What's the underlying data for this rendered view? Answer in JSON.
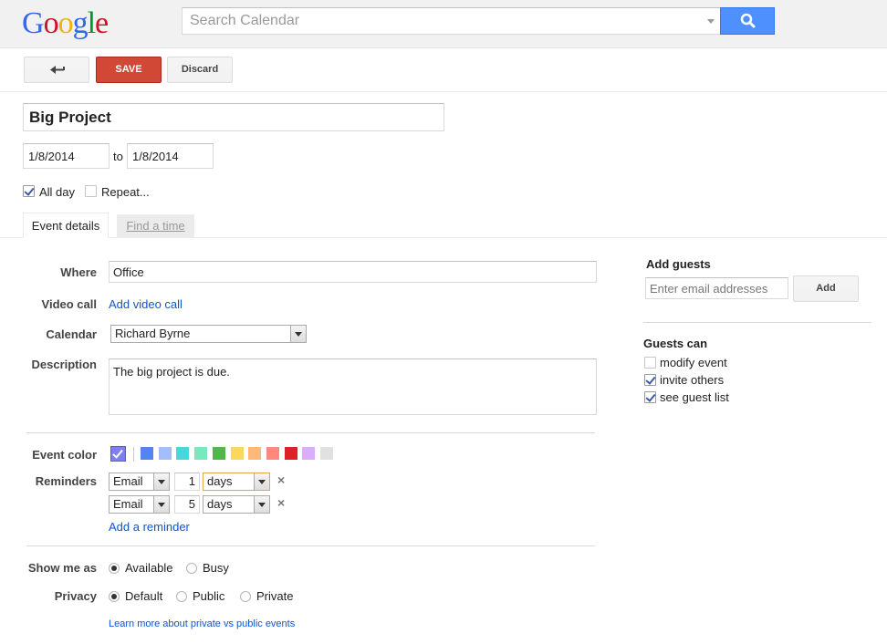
{
  "header": {
    "logo_text": "Google",
    "search_placeholder": "Search Calendar"
  },
  "toolbar": {
    "save_label": "SAVE",
    "discard_label": "Discard"
  },
  "event": {
    "title": "Big Project",
    "start_date": "1/8/2014",
    "to_label": "to",
    "end_date": "1/8/2014",
    "all_day_label": "All day",
    "all_day_checked": true,
    "repeat_label": "Repeat...",
    "repeat_checked": false
  },
  "tabs": {
    "details": "Event details",
    "find_time": "Find a time"
  },
  "form": {
    "where_label": "Where",
    "where_value": "Office",
    "video_label": "Video call",
    "video_link": "Add video call",
    "calendar_label": "Calendar",
    "calendar_value": "Richard Byrne",
    "description_label": "Description",
    "description_value": "The big project is due.",
    "color_label": "Event color",
    "colors": [
      "#5484ed",
      "#a4bdfc",
      "#46d6db",
      "#7ae7bf",
      "#51b749",
      "#fbd75b",
      "#ffb878",
      "#ff887c",
      "#dc2127",
      "#dbadff",
      "#e1e1e1"
    ],
    "selected_color": "#7f7ff0",
    "reminders_label": "Reminders",
    "reminders": [
      {
        "method": "Email",
        "amount": "1",
        "unit": "days"
      },
      {
        "method": "Email",
        "amount": "5",
        "unit": "days"
      }
    ],
    "add_reminder": "Add a reminder",
    "show_me_as_label": "Show me as",
    "show_available": "Available",
    "show_busy": "Busy",
    "privacy_label": "Privacy",
    "privacy_default": "Default",
    "privacy_public": "Public",
    "privacy_private": "Private",
    "learn_more": "Learn more about private vs public events"
  },
  "guests": {
    "title": "Add guests",
    "input_placeholder": "Enter email addresses",
    "add_label": "Add",
    "can_title": "Guests can",
    "permissions": [
      {
        "label": "modify event",
        "checked": false
      },
      {
        "label": "invite others",
        "checked": true
      },
      {
        "label": "see guest list",
        "checked": true
      }
    ]
  }
}
